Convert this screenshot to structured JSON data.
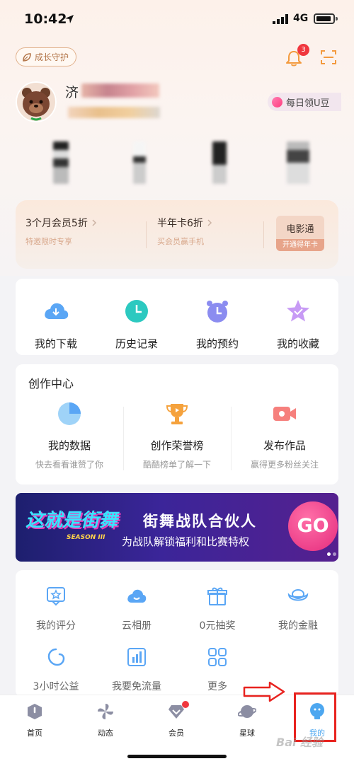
{
  "status_bar": {
    "time": "10:42",
    "network": "4G"
  },
  "header": {
    "growth_button": "成长守护",
    "notification_count": "3"
  },
  "profile": {
    "name_visible_char": "济",
    "uban_label": "每日领U豆"
  },
  "vip": {
    "offer1_title": "3个月会员5折",
    "offer1_sub": "特邀限时专享",
    "offer2_title": "半年卡6折",
    "offer2_sub": "买会员赢手机",
    "movie_title": "电影通",
    "movie_sub": "开通得年卡"
  },
  "quick_actions": [
    {
      "label": "我的下载",
      "icon": "download-cloud-icon",
      "color": "#5aa6f5"
    },
    {
      "label": "历史记录",
      "icon": "clock-icon",
      "color": "#2cc9c0"
    },
    {
      "label": "我的预约",
      "icon": "alarm-clock-icon",
      "color": "#8b8cf0"
    },
    {
      "label": "我的收藏",
      "icon": "star-icon",
      "color": "#c79af5"
    }
  ],
  "creation": {
    "title": "创作中心",
    "items": [
      {
        "label": "我的数据",
        "sub": "快去看看谁赞了你",
        "icon": "pie-chart-icon"
      },
      {
        "label": "创作荣誉榜",
        "sub": "酷酷榜单了解一下",
        "icon": "trophy-icon"
      },
      {
        "label": "发布作品",
        "sub": "赢得更多粉丝关注",
        "icon": "video-camera-icon"
      }
    ]
  },
  "banner": {
    "logo": "这就是街舞",
    "season": "SEASON III",
    "title": "街舞战队合伙人",
    "subtitle": "为战队解锁福利和比赛特权",
    "cta": "GO"
  },
  "services": [
    {
      "label": "我的评分",
      "icon": "rating-icon"
    },
    {
      "label": "云相册",
      "icon": "cloud-album-icon"
    },
    {
      "label": "0元抽奖",
      "icon": "gift-icon"
    },
    {
      "label": "我的金融",
      "icon": "gold-ingot-icon"
    },
    {
      "label": "3小时公益",
      "icon": "charity-icon"
    },
    {
      "label": "我要免流量",
      "icon": "data-chart-icon"
    },
    {
      "label": "更多",
      "icon": "grid-more-icon"
    }
  ],
  "tabs": [
    {
      "label": "首页",
      "icon": "home-icon"
    },
    {
      "label": "动态",
      "icon": "pinwheel-icon"
    },
    {
      "label": "会员",
      "icon": "diamond-icon"
    },
    {
      "label": "星球",
      "icon": "planet-icon"
    },
    {
      "label": "我的",
      "icon": "profile-bulb-icon"
    }
  ],
  "colors": {
    "accent": "#5aa6f5",
    "annotation": "#e8231f",
    "badge": "#f0373e"
  },
  "watermark": "Bai 经验"
}
